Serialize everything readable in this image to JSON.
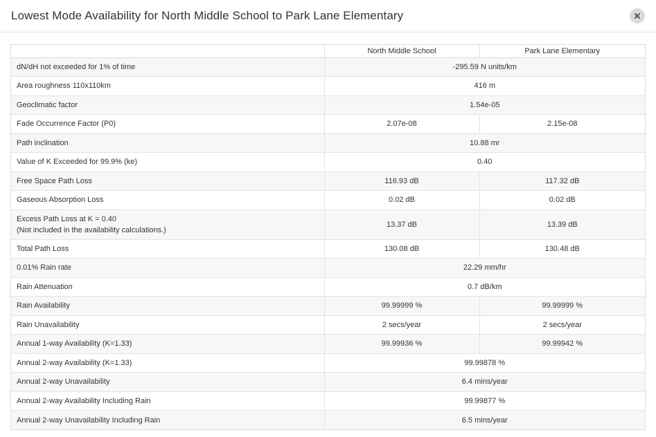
{
  "modal": {
    "title": "Lowest Mode Availability for North Middle School to Park Lane Elementary",
    "close_icon": "close-icon"
  },
  "columns": {
    "site_a": "North Middle School",
    "site_b": "Park Lane Elementary"
  },
  "rows": [
    {
      "label": "dN/dH not exceeded for 1% of time",
      "value": "-295.59 N units/km"
    },
    {
      "label": "Area roughness 110x110km",
      "value": "416 m"
    },
    {
      "label": "Geoclimatic factor",
      "value": "1.54e-05"
    },
    {
      "label": "Fade Occurrence Factor (P0)",
      "a": "2.07e-08",
      "b": "2.15e-08"
    },
    {
      "label": "Path inclination",
      "value": "10.88 mr"
    },
    {
      "label": "Value of K Exceeded for 99.9% (ke)",
      "value": "0.40"
    },
    {
      "label": "Free Space Path Loss",
      "a": "116.93 dB",
      "b": "117.32 dB"
    },
    {
      "label": "Gaseous Absorption Loss",
      "a": "0.02 dB",
      "b": "0.02 dB"
    },
    {
      "label": "Excess Path Loss at K = 0.40",
      "note": "(Not included in the availability calculations.)",
      "a": "13.37 dB",
      "b": "13.39 dB"
    },
    {
      "label": "Total Path Loss",
      "a": "130.08 dB",
      "b": "130.48 dB"
    },
    {
      "label": "0.01% Rain rate",
      "value": "22.29 mm/hr"
    },
    {
      "label": "Rain Attenuation",
      "value": "0.7 dB/km"
    },
    {
      "label": "Rain Availability",
      "a": "99.99999 %",
      "b": "99.99999 %"
    },
    {
      "label": "Rain Unavailability",
      "a": "2 secs/year",
      "b": "2 secs/year"
    },
    {
      "label": "Annual 1-way Availability (K=1.33)",
      "a": "99.99936 %",
      "b": "99.99942 %"
    },
    {
      "label": "Annual 2-way Availability (K=1.33)",
      "value": "99.99878 %"
    },
    {
      "label": "Annual 2-way Unavailability",
      "value": "6.4 mins/year"
    },
    {
      "label": "Annual 2-way Availability Including Rain",
      "value": "99.99877 %"
    },
    {
      "label": "Annual 2-way Unavailability Including Rain",
      "value": "6.5 mins/year"
    }
  ]
}
